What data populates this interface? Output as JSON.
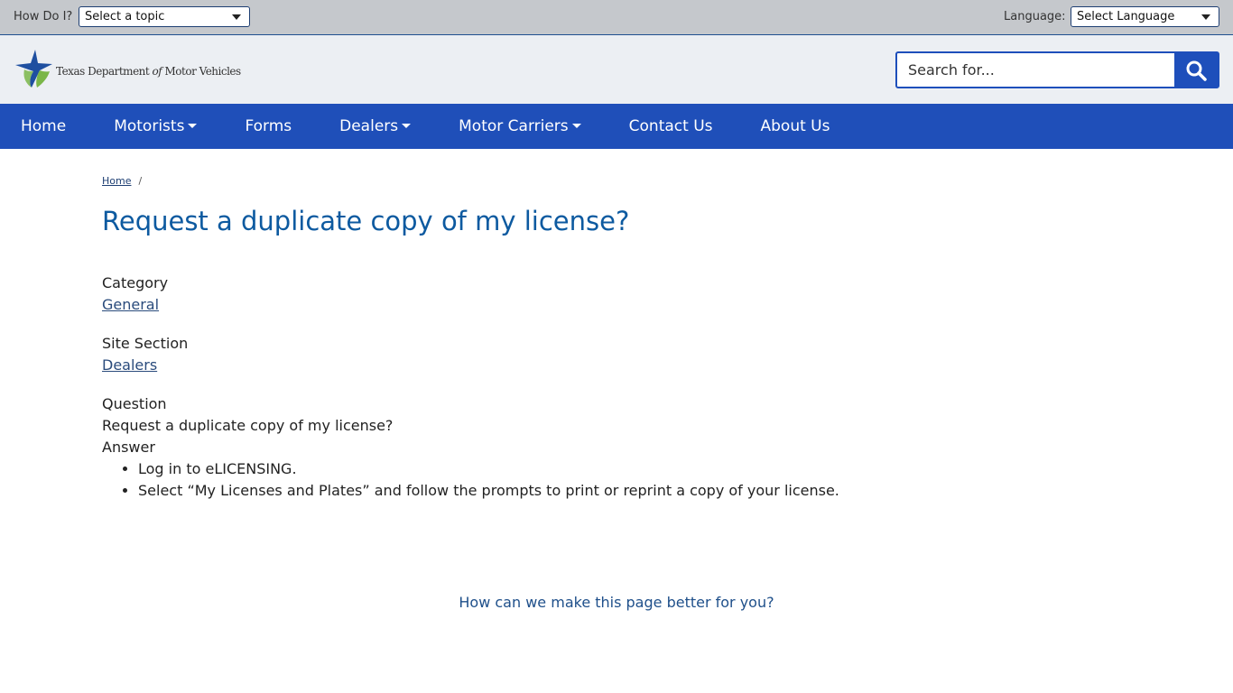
{
  "utility": {
    "how_do_i_label": "How Do I?",
    "topic_select_value": "Select a topic",
    "language_label": "Language:",
    "language_select_value": "Select Language"
  },
  "header": {
    "logo_text_pre": "Texas Department ",
    "logo_text_of": "of",
    "logo_text_post": " Motor Vehicles",
    "search_placeholder": "Search for...",
    "search_icon": "search-icon"
  },
  "nav": {
    "items": [
      {
        "label": "Home"
      },
      {
        "label": "Motorists"
      },
      {
        "label": "Forms"
      },
      {
        "label": "Dealers"
      },
      {
        "label": "Motor Carriers"
      },
      {
        "label": "Contact Us"
      },
      {
        "label": "About Us"
      }
    ]
  },
  "breadcrumb": {
    "home": "Home",
    "separator": "/"
  },
  "page": {
    "title": "Request a duplicate copy of my license?",
    "category_label": "Category",
    "category_value": "General",
    "site_section_label": "Site Section",
    "site_section_value": "Dealers",
    "question_label": "Question",
    "question_value": "Request a duplicate copy of my license?",
    "answer_label": "Answer",
    "answer_items": [
      "Log in to eLICENSING.",
      "Select “My Licenses and Plates” and follow the prompts to print or reprint a copy of your license."
    ]
  },
  "feedback": {
    "text": "How can we make this page better for you?"
  },
  "colors": {
    "nav_bg": "#1f4fb9",
    "title": "#0d5aa0",
    "utility_bg": "#c5c8cc",
    "header_bg": "#eceff3"
  }
}
